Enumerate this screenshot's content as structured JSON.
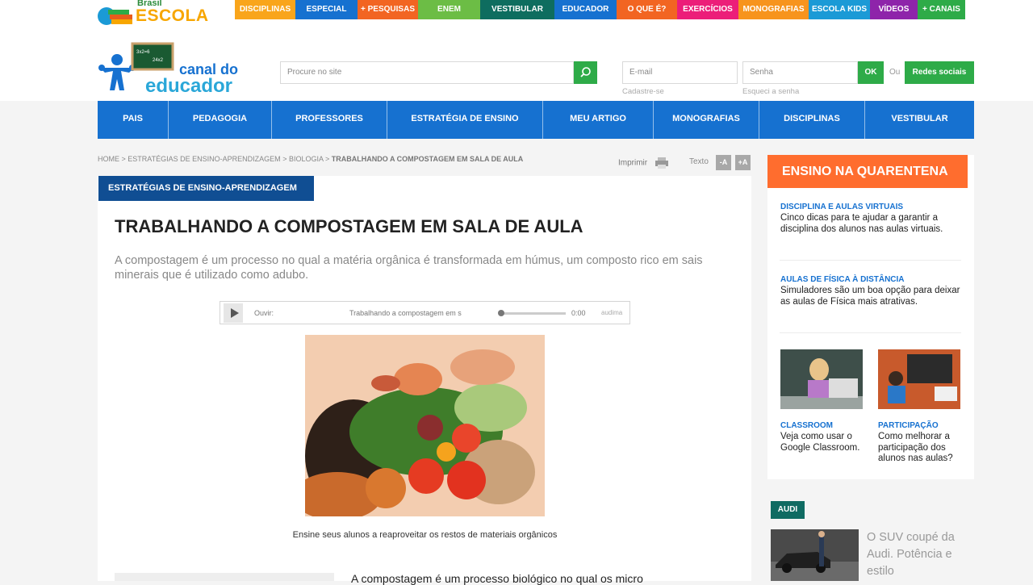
{
  "brand": {
    "small": "Brasil",
    "big": "ESCOLA"
  },
  "topnav": [
    {
      "label": "DISCIPLINAS",
      "color": "#f9a51b"
    },
    {
      "label": "ESPECIAL",
      "color": "#1671d0"
    },
    {
      "label": "+ PESQUISAS",
      "color": "#f26522"
    },
    {
      "label": "ENEM",
      "color": "#6cbd45"
    },
    {
      "label": "VESTIBULAR",
      "color": "#0e6d5f"
    },
    {
      "label": "EDUCADOR",
      "color": "#1671d0"
    },
    {
      "label": "O QUE É?",
      "color": "#f26522"
    },
    {
      "label": "EXERCÍCIOS",
      "color": "#ec1e79"
    },
    {
      "label": "MONOGRAFIAS",
      "color": "#f7941d"
    },
    {
      "label": "ESCOLA KIDS",
      "color": "#1b9ad6"
    },
    {
      "label": "VÍDEOS",
      "color": "#8e24aa"
    },
    {
      "label": "+ CANAIS",
      "color": "#2eab48"
    }
  ],
  "logo": {
    "line1": "canal do",
    "line2": "educador",
    "board1": "3x2=6",
    "board2": "24x2"
  },
  "search": {
    "placeholder": "Procure no site"
  },
  "login": {
    "email_placeholder": "E-mail",
    "password_placeholder": "Senha",
    "ok": "OK",
    "ou": "Ou",
    "social": "Redes sociais",
    "register": "Cadastre-se",
    "forgot": "Esqueci a senha"
  },
  "mainnav": [
    "PAIS",
    "PEDAGOGIA",
    "PROFESSORES",
    "ESTRATÉGIA DE ENSINO",
    "MEU ARTIGO",
    "MONOGRAFIAS",
    "DISCIPLINAS",
    "VESTIBULAR"
  ],
  "breadcrumb": {
    "home": "HOME",
    "sep": ">",
    "level1": "ESTRATÉGIAS DE ENSINO-APRENDIZAGEM",
    "level2": "BIOLOGIA",
    "current": "TRABALHANDO A COMPOSTAGEM EM SALA DE AULA"
  },
  "tools": {
    "print": "Imprimir",
    "text": "Texto",
    "minus": "-A",
    "plus": "+A"
  },
  "article": {
    "category": "ESTRATÉGIAS DE ENSINO-APRENDIZAGEM",
    "title": "TRABALHANDO A COMPOSTAGEM EM SALA DE AULA",
    "lead": "A compostagem é um processo no qual a matéria orgânica é transformada em húmus, um composto rico em sais minerais que é utilizado como adubo.",
    "audio": {
      "label": "Ouvir:",
      "title": "Trabalhando a compostagem em s",
      "time": "0:00",
      "brand": "audima",
      "progress": 0
    },
    "caption": "Ensine seus alunos a reaproveitar os restos de materiais orgânicos",
    "body_start": "A compostagem é um processo biológico no qual os micro"
  },
  "sidebar": {
    "heading": "ENSINO NA QUARENTENA",
    "items": [
      {
        "category": "DISCIPLINA E AULAS VIRTUAIS",
        "text": "Cinco dicas para te ajudar a garantir a disciplina dos alunos nas aulas virtuais."
      },
      {
        "category": "AULAS DE FÍSICA À DISTÂNCIA",
        "text": "Simuladores são um boa opção para deixar as aulas de Física mais atrativas."
      },
      {
        "category": "CLASSROOM",
        "text": "Veja como usar o Google Classroom."
      },
      {
        "category": "PARTICIPAÇÃO",
        "text": "Como melhorar a participação dos alunos nas aulas?"
      }
    ]
  },
  "ad": {
    "tag": "AUDI",
    "text": "O SUV coupé da Audi. Potência e estilo"
  }
}
